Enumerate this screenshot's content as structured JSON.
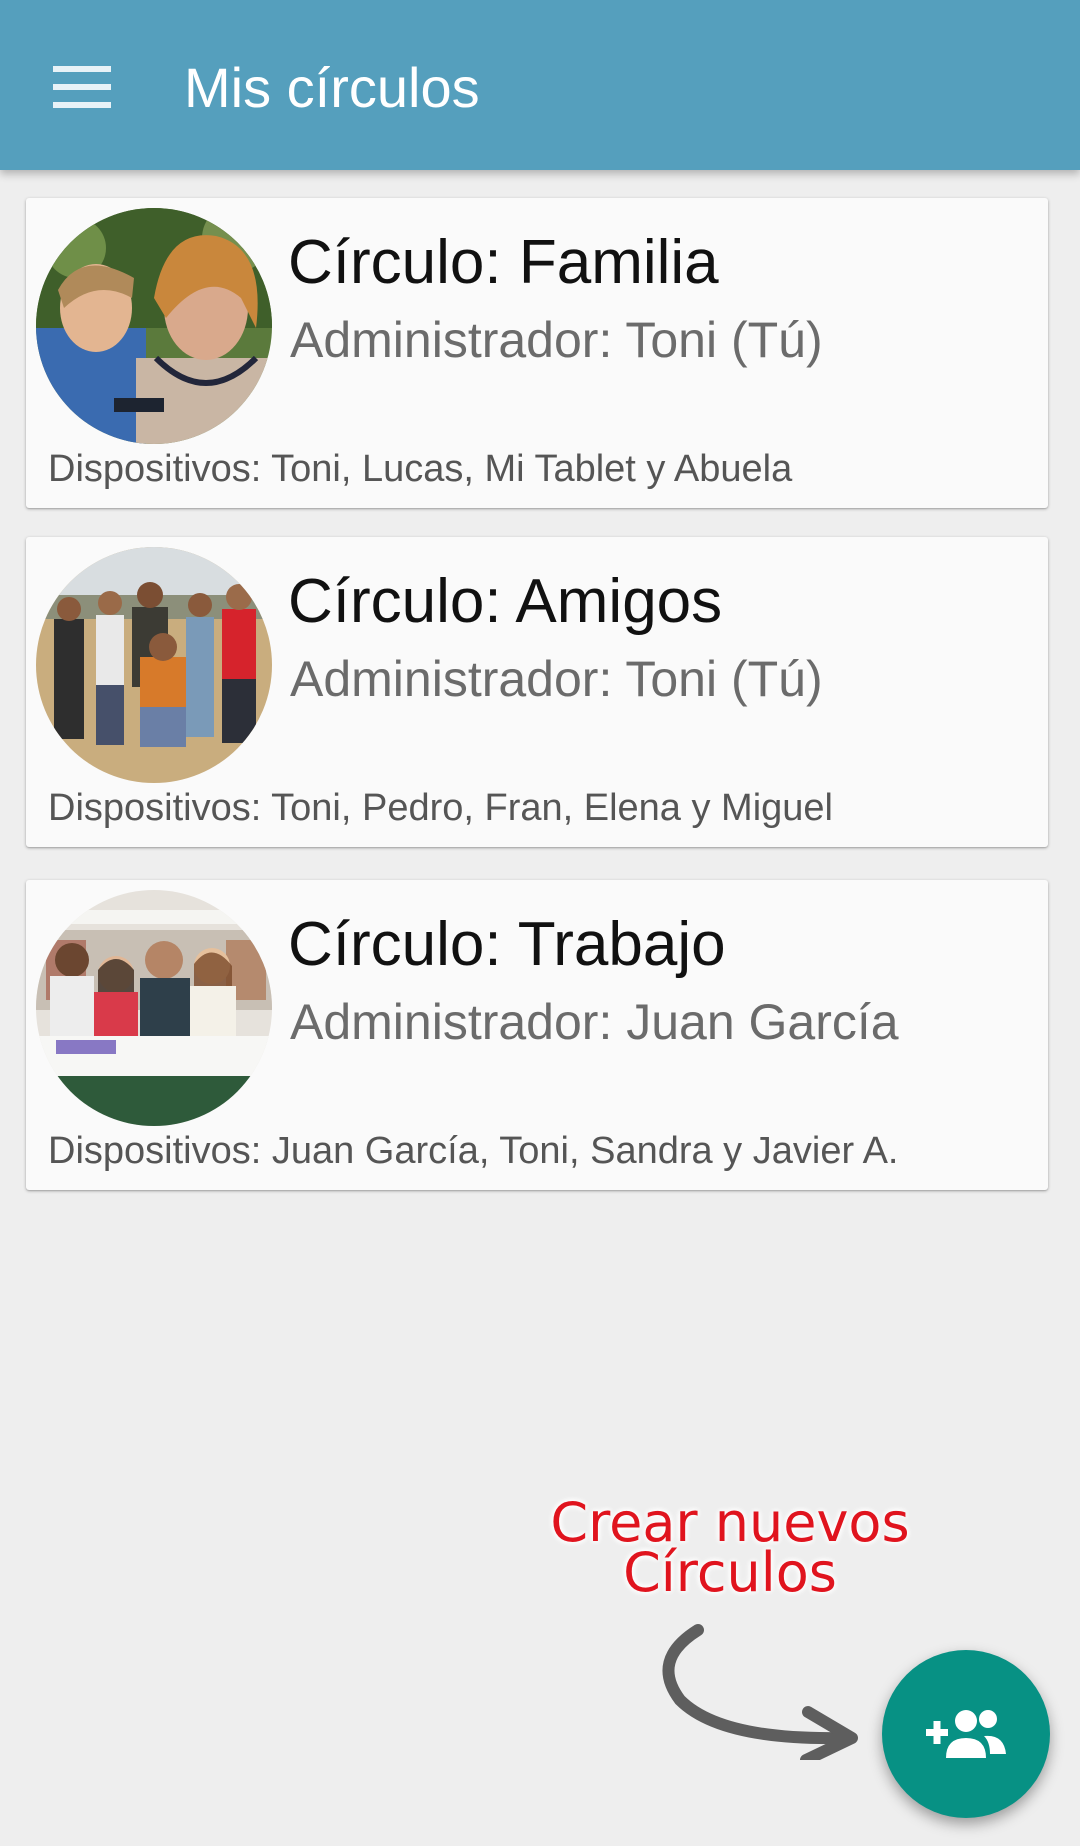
{
  "appbar": {
    "title": "Mis círculos",
    "menu_icon": "hamburger-menu-icon",
    "color": "#559fbd"
  },
  "circles": [
    {
      "title": "Círculo: Familia",
      "admin": "Administrador: Toni (Tú)",
      "devices": "Dispositivos: Toni, Lucas, Mi Tablet y Abuela",
      "photo": "family-photo"
    },
    {
      "title": "Círculo: Amigos",
      "admin": "Administrador: Toni (Tú)",
      "devices": "Dispositivos: Toni, Pedro, Fran, Elena y Miguel",
      "photo": "friends-photo"
    },
    {
      "title": "Círculo: Trabajo",
      "admin": "Administrador: Juan García",
      "devices": "Dispositivos: Juan García, Toni, Sandra y Javier A.",
      "photo": "coworkers-photo"
    }
  ],
  "hint": {
    "line1": "Crear nuevos",
    "line2": "Círculos",
    "color": "#e0141e"
  },
  "fab": {
    "icon": "group-add-icon",
    "color": "#079184"
  }
}
